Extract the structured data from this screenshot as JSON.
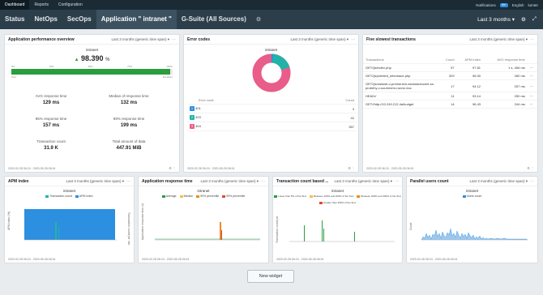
{
  "topbar": {
    "tabs": [
      "Dashboard",
      "Reports",
      "Configuration"
    ],
    "notifications_label": "Notifications",
    "notifications_count": "99+",
    "language": "English",
    "user": "lumter"
  },
  "nav": {
    "tabs": [
      "Status",
      "NetOps",
      "SecOps",
      "Application \" intranet \"",
      "G-Suite (All Sources)"
    ],
    "time_range": "Last 3 months"
  },
  "colors": {
    "topbar": "#1b2b36",
    "navbar": "#2c3e4a",
    "good": "#2a9d3f",
    "pink": "#e85d8a",
    "blue": "#2c8fe0",
    "teal": "#22b3a8"
  },
  "apdex": {
    "title": "Application performance overview",
    "span": "Last 3 months (generic time span)",
    "app": "intranet",
    "score": "98.390",
    "unit": "%",
    "fraction": 0.9839,
    "scale_ticks": [
      "0%",
      "25%",
      "50%",
      "75%",
      "100%"
    ],
    "poor_label": "Poor",
    "excellent_label": "Excellent",
    "metrics": [
      {
        "label": "AVG response time",
        "value": "129 ms"
      },
      {
        "label": "Median of response time",
        "value": "132 ms"
      },
      {
        "label": "95% response time",
        "value": "157 ms"
      },
      {
        "label": "99% response time",
        "value": "199 ms"
      },
      {
        "label": "Transaction count",
        "value": "31.9 K"
      },
      {
        "label": "Total amount of data",
        "value": "447.91 MiB"
      }
    ],
    "footer": "2020-02-28 06:24 - 2020-05-28 06:24"
  },
  "errors": {
    "title": "Error codes",
    "span": "Last 3 months (generic time span)",
    "app": "intranet",
    "col_code": "Error code",
    "col_count": "Count",
    "rows": [
      {
        "badge": "1",
        "code": "401",
        "count": "3",
        "color": "#2c8fe0"
      },
      {
        "badge": "2",
        "code": "403",
        "count": "42",
        "color": "#22b3a8"
      },
      {
        "badge": "3",
        "code": "404",
        "count": "357",
        "color": "#e85d8a"
      }
    ],
    "footer": "2020-02-28 06:24 - 2020-05-28 06:24"
  },
  "slowest": {
    "title": "Five slowest transactions",
    "span": "Last 3 months (generic time span)",
    "headers": [
      "Transactions",
      "Count",
      "APM Index",
      "AVG response time"
    ],
    "rows": [
      {
        "name": "GET//js/index.php",
        "count": "57",
        "apm": "97.81",
        "avg": "1 s, 406 ms"
      },
      {
        "name": "GET//js/prehled_informace.php",
        "count": "329",
        "apm": "96.00",
        "avg": "282 ms"
      },
      {
        "name": "GET//js/zadosti-o-premeneni-zadostuducent za-prubehy-v-souhrnem-rozvrz.doc",
        "count": "17",
        "apm": "94.12",
        "avg": "257 ms"
      },
      {
        "name": "HEAD//",
        "count": "11",
        "apm": "93.14",
        "avg": "250 ms"
      },
      {
        "name": "GET//http://10.249.212.4a/budget",
        "count": "14",
        "apm": "96.43",
        "avg": "244 ms"
      }
    ],
    "footer": "2020-02-28 06:24 - 2020-05-28 06:24"
  },
  "apm_index": {
    "title": "APM index",
    "span": "Last 3 months (generic time span)",
    "app": "intranet",
    "legend": [
      "Transaction count",
      "APM index"
    ],
    "ylabel": "APM index (%)",
    "y2label": "Transaction count per min",
    "footer": "2020-02-28 06:24 - 2020-05-28 06:24"
  },
  "response_time": {
    "title": "Application response time",
    "span": "Last 3 months (generic time span)",
    "app": "intranet",
    "legend": [
      "Average",
      "Median",
      "90% percentile",
      "99% percentile"
    ],
    "ylabel": "Application response time (s)",
    "footer": "2020-02-28 06:24 - 2020-05-28 06:24"
  },
  "tx_count": {
    "title": "Transaction count based ...",
    "span": "Last 3 months (generic time span)",
    "app": "intranet",
    "legend": [
      "Lower than 5% of the SLA",
      "Between 100% and 200% of the SLA",
      "Between 200% and 300% of the SLA",
      "Greater than 300% of the SLA"
    ],
    "ylabel": "Transaction count per",
    "footer": "2020-02-28 06:24 - 2020-05-28 06:24"
  },
  "users": {
    "title": "Parallel users count",
    "span": "Last 3 months (generic time span)",
    "app": "intranet",
    "legend": [
      "Users count"
    ],
    "ylabel": "Count",
    "footer": "2020-02-28 06:24 - 2020-05-28 06:24"
  },
  "new_widget_label": "New widget"
}
